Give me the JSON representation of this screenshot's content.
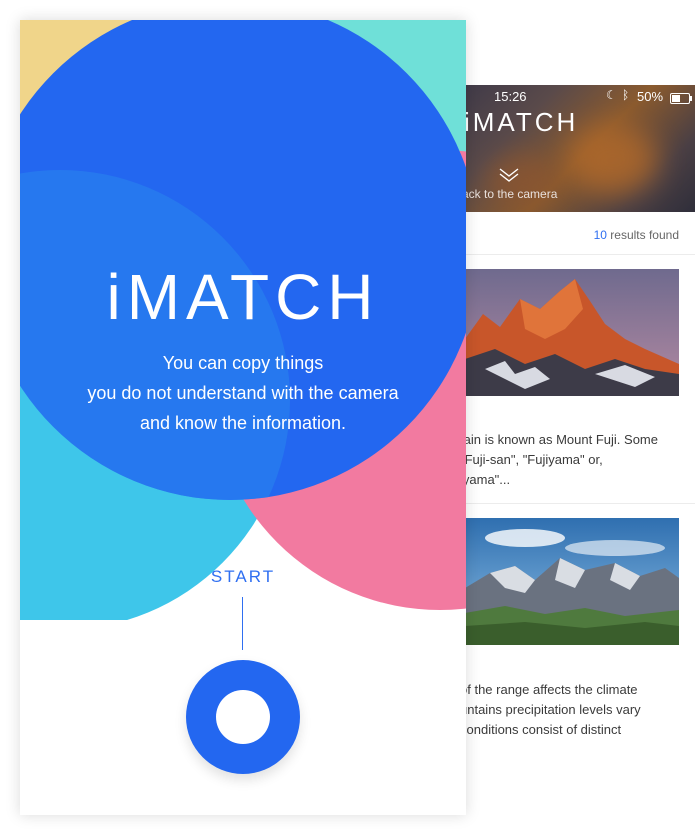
{
  "back_screen": {
    "status_bar": {
      "time": "15:26",
      "battery": "50%",
      "battery_level": 0.5
    },
    "logo": "iMATCH",
    "back_label": "ack to the camera",
    "results": {
      "count": "10",
      "label": " results found"
    },
    "cards": [
      {
        "image": "sunset-mountain-peaks",
        "description_lines": [
          "tain is known as Mount Fuji. Some",
          " \"Fuji-san\", \"Fujiyama\" or,",
          "iyama\"..."
        ]
      },
      {
        "image": "alpine-mountain-range",
        "description_lines": [
          " of the range affects the climate",
          "untains precipitation levels vary",
          "conditions consist of distinct"
        ]
      }
    ]
  },
  "front_screen": {
    "logo": "iMATCH",
    "tagline": [
      "You can copy things",
      "you do not understand with the camera",
      "and know the information."
    ],
    "start_label": "START"
  },
  "colors": {
    "blue": "#2367f0",
    "cyan": "#3ec6ea",
    "pink": "#f27aa0",
    "yellow": "#f0d58a",
    "teal": "#6fe0d8"
  }
}
